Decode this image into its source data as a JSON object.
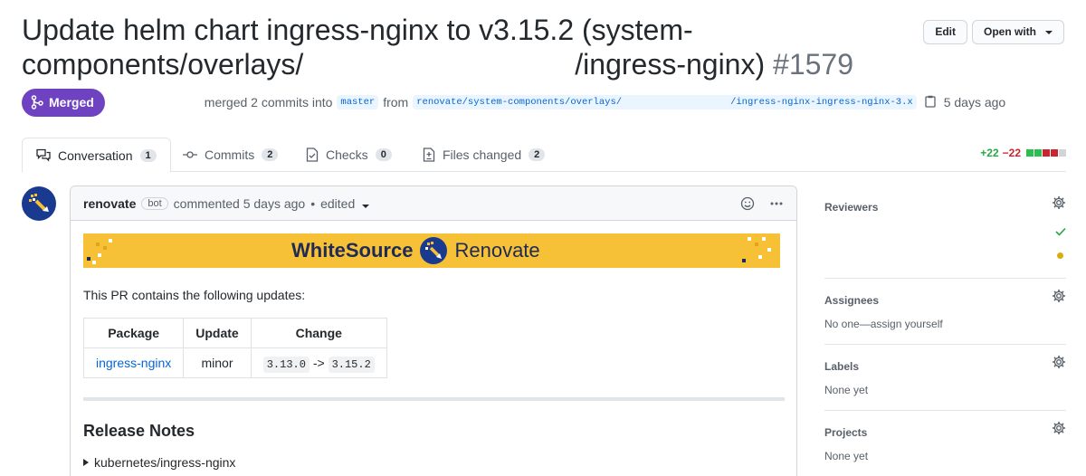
{
  "pr": {
    "title_part1": "Update helm chart ingress-nginx to v3.15.2 (system-components/overlays/",
    "title_part2": "/ingress-nginx)",
    "number": "#1579",
    "edit_label": "Edit",
    "open_with_label": "Open with",
    "status": "Merged",
    "meta_merged": "merged 2 commits into",
    "base_branch": "master",
    "meta_from": "from",
    "head_branch_part1": "renovate/system-components/overlays/",
    "head_branch_part2": "/ingress-nginx-ingress-nginx-3.x",
    "merged_time": "5 days ago"
  },
  "tabs": [
    {
      "label": "Conversation",
      "count": "1"
    },
    {
      "label": "Commits",
      "count": "2"
    },
    {
      "label": "Checks",
      "count": "0"
    },
    {
      "label": "Files changed",
      "count": "2"
    }
  ],
  "diffstat": {
    "additions": "+22",
    "deletions": "−22",
    "add_color": "#28a745",
    "del_color": "#cb2431"
  },
  "comment": {
    "author": "renovate",
    "bot_label": "bot",
    "action": "commented 5 days ago",
    "separator": "•",
    "edited": "edited",
    "banner_brand1": "WhiteSource",
    "banner_brand2": "Renovate",
    "intro": "This PR contains the following updates:",
    "table": {
      "headers": [
        "Package",
        "Update",
        "Change"
      ],
      "row": {
        "package": "ingress-nginx",
        "update": "minor",
        "from": "3.13.0",
        "arrow": "->",
        "to": "3.15.2"
      }
    },
    "release_heading": "Release Notes",
    "details_summary": "kubernetes/ingress-nginx"
  },
  "sidebar": {
    "reviewers": {
      "title": "Reviewers"
    },
    "assignees": {
      "title": "Assignees",
      "value": "No one—assign yourself"
    },
    "labels": {
      "title": "Labels",
      "value": "None yet"
    },
    "projects": {
      "title": "Projects",
      "value": "None yet"
    }
  },
  "colors": {
    "merged": "#6f42c1",
    "link": "#0366d6",
    "banner": "#f6c136"
  }
}
